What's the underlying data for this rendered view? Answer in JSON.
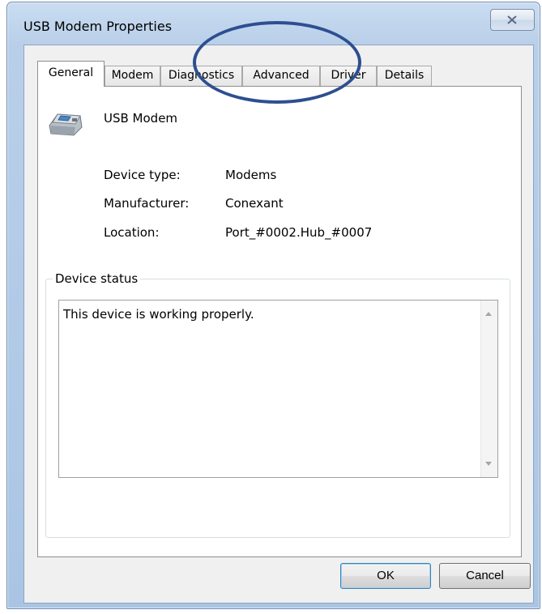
{
  "window": {
    "title": "USB Modem Properties"
  },
  "tabs": [
    {
      "label": "General",
      "active": true
    },
    {
      "label": "Modem",
      "active": false
    },
    {
      "label": "Diagnostics",
      "active": false
    },
    {
      "label": "Advanced",
      "active": false
    },
    {
      "label": "Driver",
      "active": false
    },
    {
      "label": "Details",
      "active": false
    }
  ],
  "device": {
    "name": "USB Modem",
    "icon": "modem-icon",
    "properties": [
      {
        "label": "Device type:",
        "value": "Modems"
      },
      {
        "label": "Manufacturer:",
        "value": "Conexant"
      },
      {
        "label": "Location:",
        "value": "Port_#0002.Hub_#0007"
      }
    ]
  },
  "status": {
    "group_label": "Device status",
    "text": "This device is working properly."
  },
  "buttons": {
    "ok": "OK",
    "cancel": "Cancel"
  },
  "icons": {
    "close": "close-icon",
    "scroll_up": "scroll-up-arrow-icon",
    "scroll_down": "scroll-down-arrow-icon"
  },
  "colors": {
    "annotation": "#2d4f91",
    "frame": "#aac5e4"
  }
}
